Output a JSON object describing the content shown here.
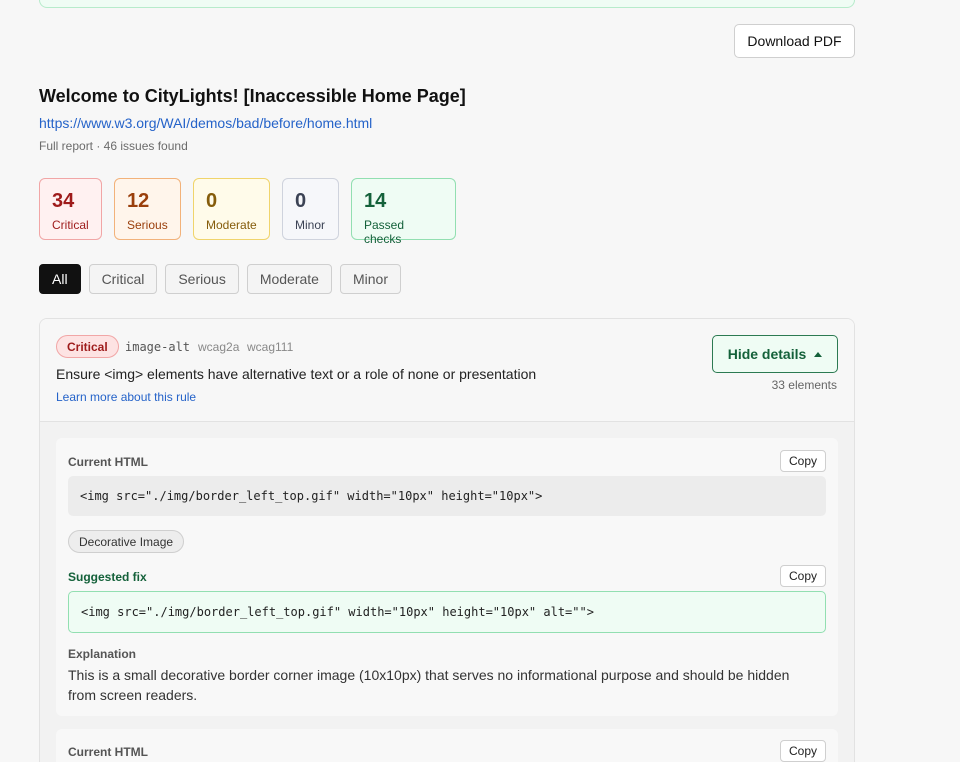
{
  "header": {
    "download_label": "Download PDF",
    "title": "Welcome to CityLights! [Inaccessible Home Page]",
    "url": "https://www.w3.org/WAI/demos/bad/before/home.html",
    "subtitle": "Full report · 46 issues found"
  },
  "stats": [
    {
      "count": "34",
      "label": "Critical"
    },
    {
      "count": "12",
      "label": "Serious"
    },
    {
      "count": "0",
      "label": "Moderate"
    },
    {
      "count": "0",
      "label": "Minor"
    },
    {
      "count": "14",
      "label": "Passed checks"
    }
  ],
  "filters": [
    "All",
    "Critical",
    "Serious",
    "Moderate",
    "Minor"
  ],
  "active_filter": "All",
  "rule": {
    "severity": "Critical",
    "id": "image-alt",
    "tags": [
      "wcag2a",
      "wcag111"
    ],
    "description": "Ensure <img> elements have alternative text or a role of none or presentation",
    "learn_more": "Learn more about this rule",
    "toggle_label": "Hide details",
    "element_count": "33 elements"
  },
  "items": [
    {
      "current_label": "Current HTML",
      "copy_label": "Copy",
      "current_html": "<img src=\"./img/border_left_top.gif\" width=\"10px\" height=\"10px\">",
      "category": "Decorative Image",
      "fix_label": "Suggested fix",
      "fix_html": "<img src=\"./img/border_left_top.gif\" width=\"10px\" height=\"10px\" alt=\"\">",
      "explanation_label": "Explanation",
      "explanation": "This is a small decorative border corner image (10x10px) that serves no informational purpose and should be hidden from screen readers."
    },
    {
      "current_label": "Current HTML",
      "copy_label": "Copy"
    }
  ],
  "colors": {
    "critical": "#9e1b1b",
    "serious": "#9a3f0c",
    "moderate": "#855c0b",
    "passed": "#14613a",
    "link": "#2563c9"
  }
}
